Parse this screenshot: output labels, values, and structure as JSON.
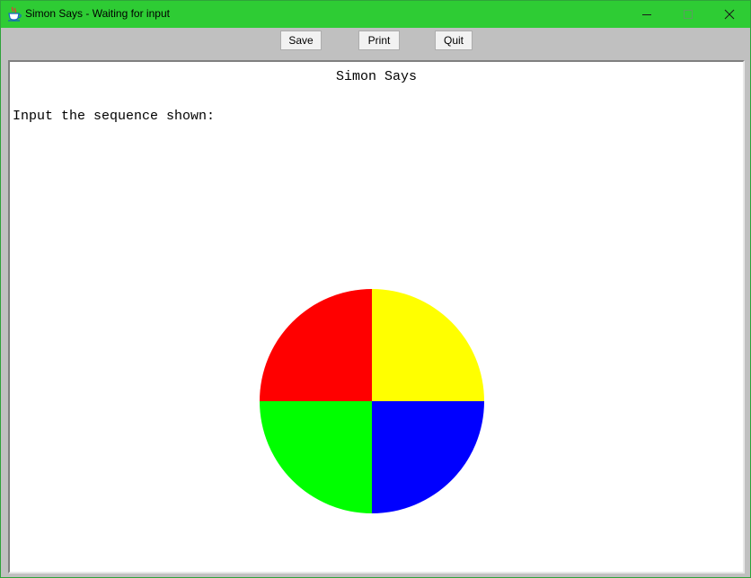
{
  "window": {
    "title": "Simon Says - Waiting for input",
    "titlebar_color": "#2ecc34"
  },
  "toolbar": {
    "save_label": "Save",
    "print_label": "Print",
    "quit_label": "Quit"
  },
  "canvas": {
    "heading": "Simon Says",
    "prompt": "Input the sequence shown:"
  },
  "simon": {
    "quadrants": [
      {
        "name": "red",
        "color": "#ff0000"
      },
      {
        "name": "yellow",
        "color": "#ffff00"
      },
      {
        "name": "green",
        "color": "#00ff00"
      },
      {
        "name": "blue",
        "color": "#0000ff"
      }
    ]
  },
  "icons": {
    "app": "java-cup-icon",
    "minimize": "minimize-icon",
    "maximize": "maximize-icon",
    "close": "close-icon"
  }
}
